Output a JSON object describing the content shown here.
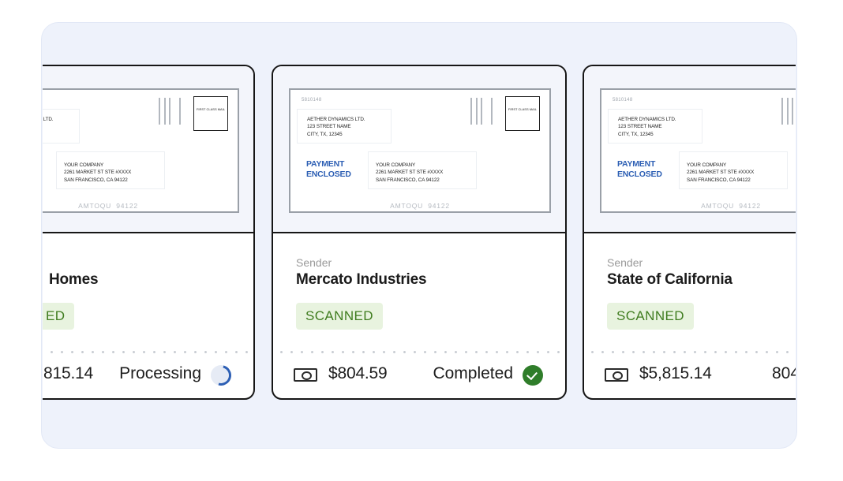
{
  "cards": [
    {
      "envelope": {
        "code": "",
        "return_lines": [
          "AETHER DYNAMICS LTD."
        ],
        "stamp": "FIRST CLASS MAIL",
        "payment_label": "",
        "dest_lines": [
          "YOUR COMPANY",
          "2261 MARKET ST STE #XXXX",
          "SAN FRANCISCO, CA 94122"
        ],
        "barcode": "AMTOQU 94122"
      },
      "sender_label": "",
      "sender_name": "Homes",
      "status": "ED",
      "amount": "815.14",
      "state": "Processing",
      "state_icon": "spinner-icon"
    },
    {
      "envelope": {
        "code": "5810148",
        "return_lines": [
          "AETHER DYNAMICS LTD.",
          "123 STREET NAME",
          "CITY, TX, 12345"
        ],
        "stamp": "FIRST CLASS MAIL",
        "payment_label": "PAYMENT ENCLOSED",
        "dest_lines": [
          "YOUR COMPANY",
          "2261 MARKET ST STE #XXXX",
          "SAN FRANCISCO, CA 94122"
        ],
        "barcode": "AMTOQU 94122"
      },
      "sender_label": "Sender",
      "sender_name": "Mercato Industries",
      "status": "SCANNED",
      "amount": "$804.59",
      "state": "Completed",
      "state_icon": "check-icon"
    },
    {
      "envelope": {
        "code": "5810148",
        "return_lines": [
          "AETHER DYNAMICS LTD.",
          "123 STREET NAME",
          "CITY, TX, 12345"
        ],
        "stamp": "",
        "payment_label": "PAYMENT ENCLOSED",
        "dest_lines": [
          "YOUR COMPANY",
          "2261 MARKET ST STE #XXXX",
          "SAN FRANCISCO, CA 94122"
        ],
        "barcode": "AMTOQU 94122"
      },
      "sender_label": "Sender",
      "sender_name": "State of California",
      "status": "SCANNED",
      "amount": "$5,815.14",
      "state": "804",
      "state_icon": ""
    }
  ],
  "colors": {
    "panel_bg": "#eef2fb",
    "card_border": "#161616",
    "scanned_bg": "#e8f3df",
    "scanned_text": "#3f7c1f",
    "payment_blue": "#2d5fb4",
    "completed_green": "#2f7d2a"
  }
}
